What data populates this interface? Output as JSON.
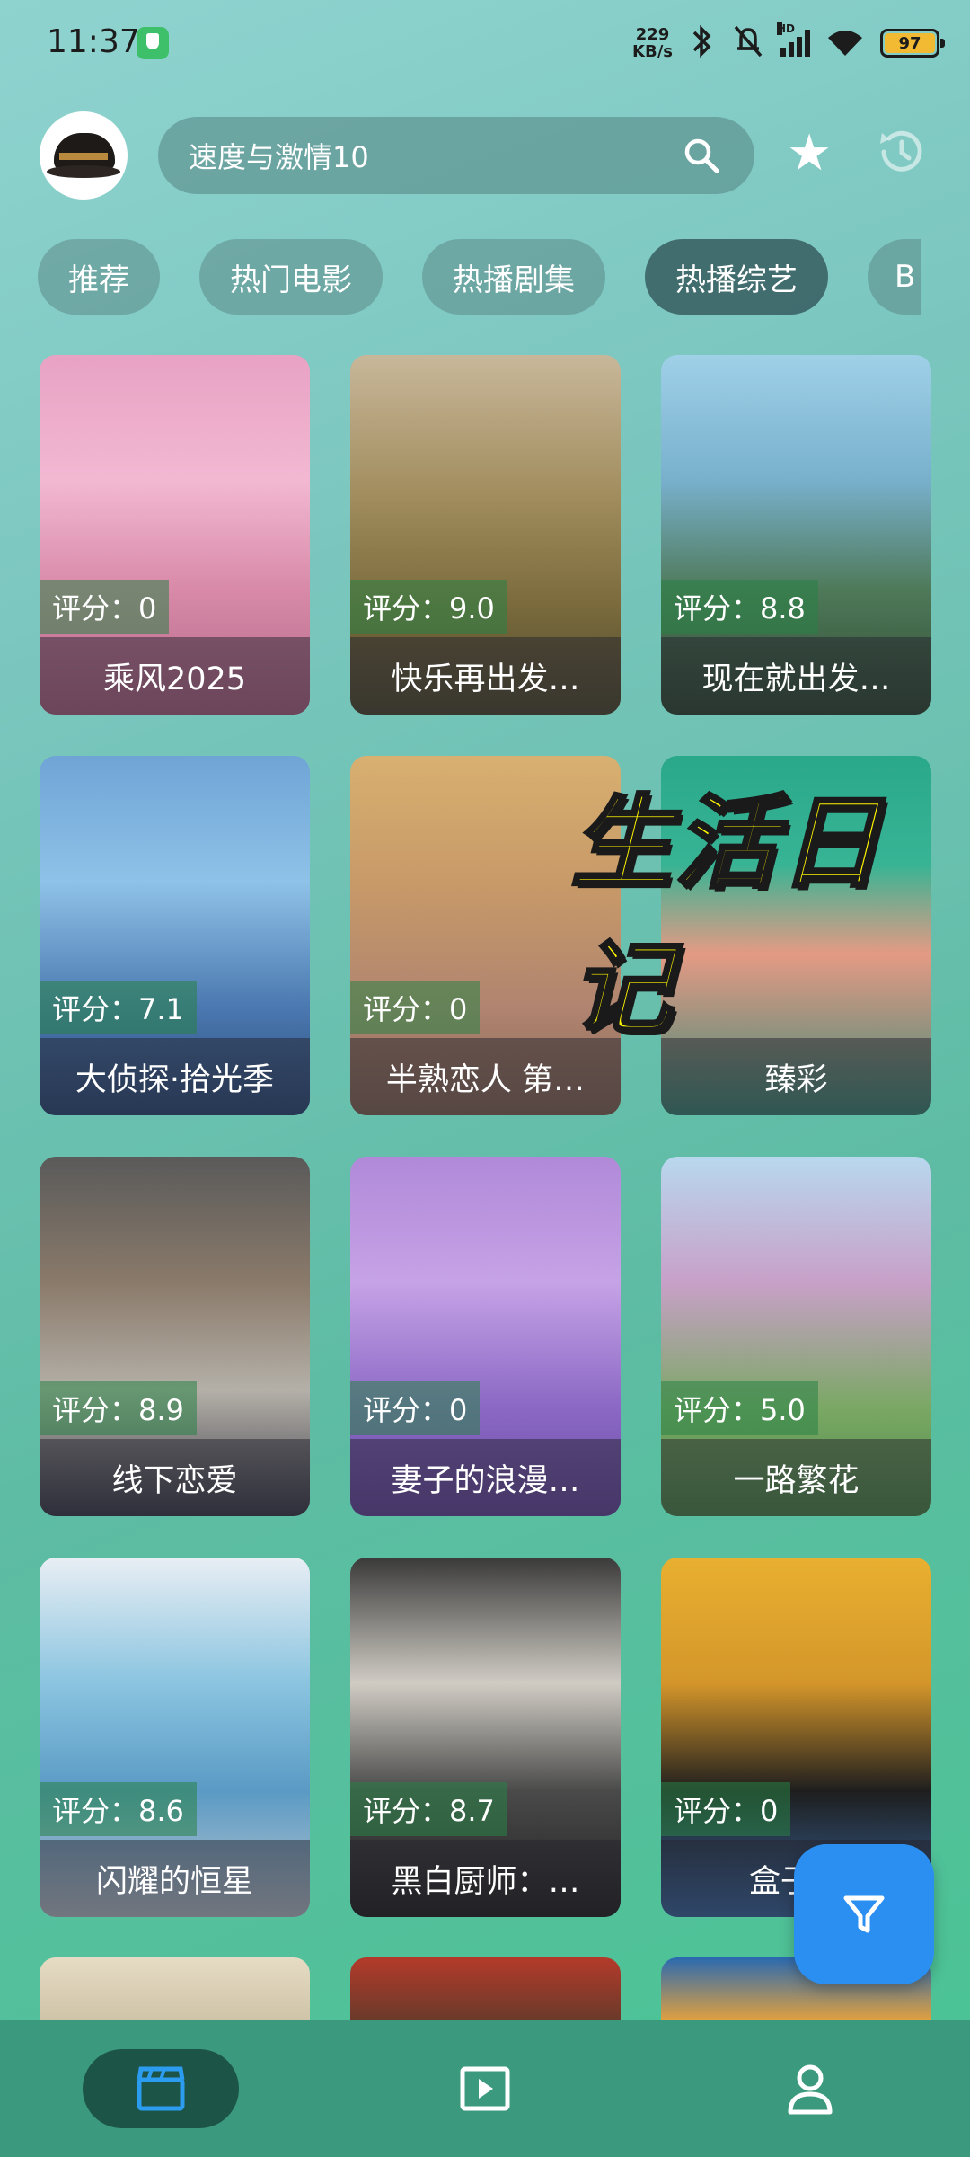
{
  "status_bar": {
    "time": "11:37",
    "net_speed_value": "229",
    "net_speed_unit": "KB/s",
    "network_label": "HD",
    "battery": "97"
  },
  "header": {
    "search_value": "速度与激情10"
  },
  "tabs": [
    {
      "label": "推荐"
    },
    {
      "label": "热门电影"
    },
    {
      "label": "热播剧集"
    },
    {
      "label": "热播综艺"
    },
    {
      "label": "B"
    }
  ],
  "cards": [
    {
      "title": "乘风2025",
      "score_label": "评分：0"
    },
    {
      "title": "快乐再出发…",
      "score_label": "评分：9.0"
    },
    {
      "title": "现在就出发…",
      "score_label": "评分：8.8"
    },
    {
      "title": "大侦探·拾光季",
      "score_label": "评分：7.1"
    },
    {
      "title": "半熟恋人 第…",
      "score_label": "评分：0"
    },
    {
      "title": "臻彩",
      "score_label": ""
    },
    {
      "title": "线下恋爱",
      "score_label": "评分：8.9"
    },
    {
      "title": "妻子的浪漫…",
      "score_label": "评分：0"
    },
    {
      "title": "一路繁花",
      "score_label": "评分：5.0"
    },
    {
      "title": "闪耀的恒星",
      "score_label": "评分：8.6"
    },
    {
      "title": "黑白厨师：…",
      "score_label": "评分：8.7"
    },
    {
      "title": "盒子里",
      "score_label": "评分：0"
    }
  ],
  "overlay_text": "生活日记",
  "colors": {
    "accent_blue": "#2b8ff2",
    "score_green": "#28a050",
    "overlay_yellow": "#fff500",
    "nav_bg": "#3b9a7d"
  },
  "icons": {
    "search": "search-icon",
    "favorite": "star-icon",
    "history": "history-icon",
    "filter": "filter-icon",
    "nav_home": "clapperboard-icon",
    "nav_player": "play-box-icon",
    "nav_profile": "person-icon"
  }
}
